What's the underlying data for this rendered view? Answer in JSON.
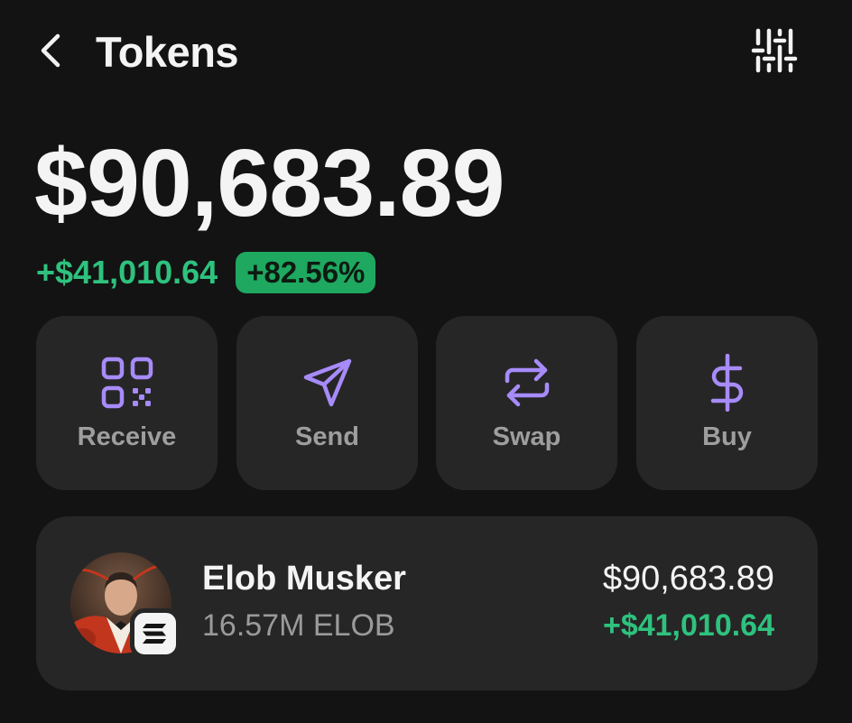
{
  "header": {
    "title": "Tokens",
    "back_icon": "chevron-left-icon",
    "filter_icon": "sliders-icon"
  },
  "portfolio": {
    "balance": "$90,683.89",
    "change_amount": "+$41,010.64",
    "change_percent": "+82.56%"
  },
  "actions": [
    {
      "label": "Receive",
      "icon": "qr-code-icon"
    },
    {
      "label": "Send",
      "icon": "send-icon"
    },
    {
      "label": "Swap",
      "icon": "swap-icon"
    },
    {
      "label": "Buy",
      "icon": "dollar-icon"
    }
  ],
  "tokens": [
    {
      "name": "Elob Musker",
      "amount": "16.57M ELOB",
      "value": "$90,683.89",
      "change": "+$41,010.64",
      "chain_icon": "solana-icon"
    }
  ],
  "colors": {
    "background": "#131313",
    "card": "#262626",
    "accent": "#a78bfa",
    "positive": "#2ec27e",
    "badge": "#1ea860"
  }
}
